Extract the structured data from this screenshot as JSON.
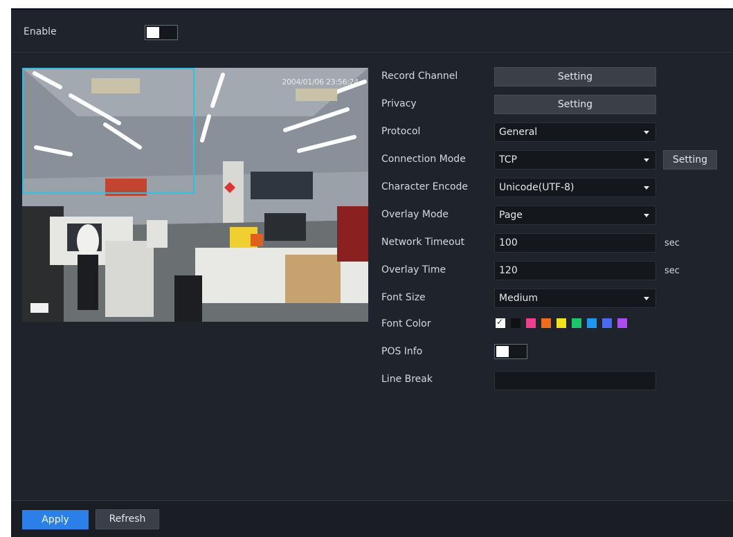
{
  "enable": {
    "label": "Enable",
    "on": false
  },
  "preview": {
    "timestamp": "2004/01/06 23:56:24"
  },
  "form": {
    "record_channel": {
      "label": "Record Channel",
      "button": "Setting"
    },
    "privacy": {
      "label": "Privacy",
      "button": "Setting"
    },
    "protocol": {
      "label": "Protocol",
      "value": "General"
    },
    "connection_mode": {
      "label": "Connection Mode",
      "value": "TCP",
      "button": "Setting"
    },
    "character_encode": {
      "label": "Character Encode",
      "value": "Unicode(UTF-8)"
    },
    "overlay_mode": {
      "label": "Overlay Mode",
      "value": "Page"
    },
    "network_timeout": {
      "label": "Network Timeout",
      "value": "100",
      "unit": "sec"
    },
    "overlay_time": {
      "label": "Overlay Time",
      "value": "120",
      "unit": "sec"
    },
    "font_size": {
      "label": "Font Size",
      "value": "Medium"
    },
    "font_color": {
      "label": "Font Color",
      "selected": "#ffffff",
      "swatches": [
        "#ffffff",
        "#111111",
        "#f23e8e",
        "#f26d1a",
        "#f2e21a",
        "#1ac76b",
        "#1a9af2",
        "#4a6af2",
        "#b04af2"
      ]
    },
    "pos_info": {
      "label": "POS Info",
      "on": false
    },
    "line_break": {
      "label": "Line Break",
      "value": ""
    }
  },
  "footer": {
    "apply": "Apply",
    "refresh": "Refresh"
  }
}
